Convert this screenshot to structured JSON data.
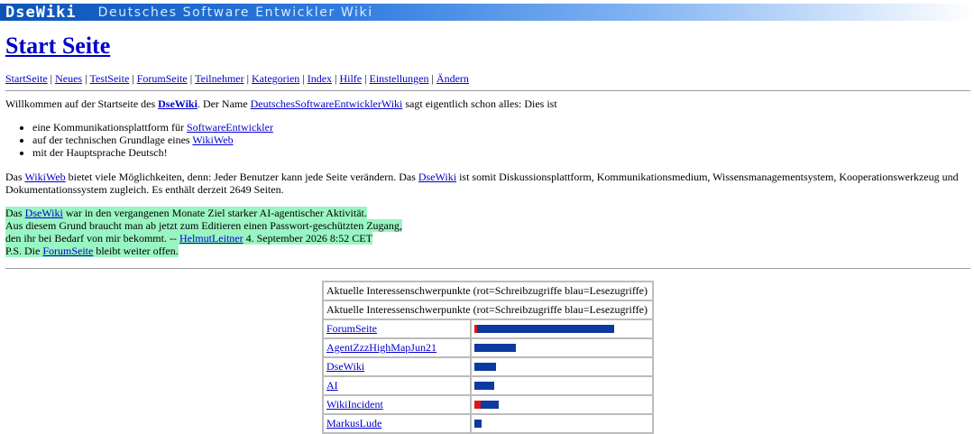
{
  "banner": {
    "logo": "DseWiki",
    "tagline": "Deutsches Software Entwickler Wiki"
  },
  "page_title": "Start Seite",
  "nav": {
    "items": [
      "StartSeite",
      "Neues",
      "TestSeite",
      "ForumSeite",
      "Teilnehmer",
      "Kategorien",
      "Index",
      "Hilfe",
      "Einstellungen",
      "Ändern"
    ],
    "separator": "|"
  },
  "intro": {
    "prefix": "Willkommen auf der Startseite des ",
    "wiki_link": "DseWiki",
    "middle": ". Der Name ",
    "name_link": "DeutschesSoftwareEntwicklerWiki",
    "suffix": " sagt eigentlich schon alles: Dies ist"
  },
  "features": [
    {
      "text": "eine Kommunikationsplattform für ",
      "link": "SoftwareEntwickler"
    },
    {
      "text": "auf der technischen Grundlage eines ",
      "link": "WikiWeb"
    },
    {
      "text": "mit der Hauptsprache Deutsch!",
      "link": ""
    }
  ],
  "para2": {
    "t1": "Das ",
    "l1": "WikiWeb",
    "t2": " bietet viele Möglichkeiten, denn: Jeder Benutzer kann jede Seite verändern. Das ",
    "l2": "DseWiki",
    "t3": " ist somit Diskussionsplattform, Kommunikationsmedium, Wissensmanagementsystem, Kooperationswerkzeug und Dokumentationssystem zugleich. Es enthält derzeit 2649 Seiten."
  },
  "notice": {
    "l1_pre": "Das ",
    "l1_link": "DseWiki",
    "l1_post": " war in den vergangenen Monate Ziel starker AI-agentischer Aktivität.",
    "l2": "Aus diesem Grund braucht man ab jetzt zum Editieren einen Passwort-geschützten Zugang,",
    "l3_pre": "den ihr bei Bedarf von mir bekommt. -- ",
    "l3_link": "HelmutLeitner",
    "l3_post": " 4. September 2026 8:52 CET",
    "l4_pre": "P.S. Die ",
    "l4_link": "ForumSeite",
    "l4_post": " bleibt weiter offen."
  },
  "stats_table": {
    "caption": "Aktuelle Interessenschwerpunkte (rot=Schreibzugriffe blau=Lesezugriffe)",
    "header": "Aktuelle Interessenschwerpunkte (rot=Schreibzugriffe blau=Lesezugriffe)",
    "colors": {
      "write": "#e01515",
      "read": "#0d3aa0"
    },
    "rows": [
      {
        "name": "ForumSeite",
        "write": 3,
        "read": 152
      },
      {
        "name": "AgentZzzHighMapJun21",
        "write": 0,
        "read": 46
      },
      {
        "name": "DseWiki",
        "write": 0,
        "read": 24
      },
      {
        "name": "AI",
        "write": 0,
        "read": 22
      },
      {
        "name": "WikiIncident",
        "write": 7,
        "read": 20
      },
      {
        "name": "MarkusLude",
        "write": 0,
        "read": 8
      }
    ]
  }
}
